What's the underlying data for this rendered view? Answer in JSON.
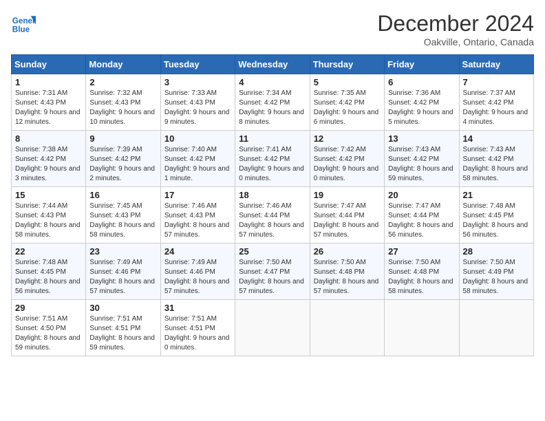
{
  "header": {
    "logo_line1": "General",
    "logo_line2": "Blue",
    "month": "December 2024",
    "location": "Oakville, Ontario, Canada"
  },
  "days_of_week": [
    "Sunday",
    "Monday",
    "Tuesday",
    "Wednesday",
    "Thursday",
    "Friday",
    "Saturday"
  ],
  "weeks": [
    [
      {
        "day": "1",
        "sunrise": "7:31 AM",
        "sunset": "4:43 PM",
        "daylight": "9 hours and 12 minutes."
      },
      {
        "day": "2",
        "sunrise": "7:32 AM",
        "sunset": "4:43 PM",
        "daylight": "9 hours and 10 minutes."
      },
      {
        "day": "3",
        "sunrise": "7:33 AM",
        "sunset": "4:43 PM",
        "daylight": "9 hours and 9 minutes."
      },
      {
        "day": "4",
        "sunrise": "7:34 AM",
        "sunset": "4:42 PM",
        "daylight": "9 hours and 8 minutes."
      },
      {
        "day": "5",
        "sunrise": "7:35 AM",
        "sunset": "4:42 PM",
        "daylight": "9 hours and 6 minutes."
      },
      {
        "day": "6",
        "sunrise": "7:36 AM",
        "sunset": "4:42 PM",
        "daylight": "9 hours and 5 minutes."
      },
      {
        "day": "7",
        "sunrise": "7:37 AM",
        "sunset": "4:42 PM",
        "daylight": "9 hours and 4 minutes."
      }
    ],
    [
      {
        "day": "8",
        "sunrise": "7:38 AM",
        "sunset": "4:42 PM",
        "daylight": "9 hours and 3 minutes."
      },
      {
        "day": "9",
        "sunrise": "7:39 AM",
        "sunset": "4:42 PM",
        "daylight": "9 hours and 2 minutes."
      },
      {
        "day": "10",
        "sunrise": "7:40 AM",
        "sunset": "4:42 PM",
        "daylight": "9 hours and 1 minute."
      },
      {
        "day": "11",
        "sunrise": "7:41 AM",
        "sunset": "4:42 PM",
        "daylight": "9 hours and 0 minutes."
      },
      {
        "day": "12",
        "sunrise": "7:42 AM",
        "sunset": "4:42 PM",
        "daylight": "9 hours and 0 minutes."
      },
      {
        "day": "13",
        "sunrise": "7:43 AM",
        "sunset": "4:42 PM",
        "daylight": "8 hours and 59 minutes."
      },
      {
        "day": "14",
        "sunrise": "7:43 AM",
        "sunset": "4:42 PM",
        "daylight": "8 hours and 58 minutes."
      }
    ],
    [
      {
        "day": "15",
        "sunrise": "7:44 AM",
        "sunset": "4:43 PM",
        "daylight": "8 hours and 58 minutes."
      },
      {
        "day": "16",
        "sunrise": "7:45 AM",
        "sunset": "4:43 PM",
        "daylight": "8 hours and 58 minutes."
      },
      {
        "day": "17",
        "sunrise": "7:46 AM",
        "sunset": "4:43 PM",
        "daylight": "8 hours and 57 minutes."
      },
      {
        "day": "18",
        "sunrise": "7:46 AM",
        "sunset": "4:44 PM",
        "daylight": "8 hours and 57 minutes."
      },
      {
        "day": "19",
        "sunrise": "7:47 AM",
        "sunset": "4:44 PM",
        "daylight": "8 hours and 57 minutes."
      },
      {
        "day": "20",
        "sunrise": "7:47 AM",
        "sunset": "4:44 PM",
        "daylight": "8 hours and 56 minutes."
      },
      {
        "day": "21",
        "sunrise": "7:48 AM",
        "sunset": "4:45 PM",
        "daylight": "8 hours and 56 minutes."
      }
    ],
    [
      {
        "day": "22",
        "sunrise": "7:48 AM",
        "sunset": "4:45 PM",
        "daylight": "8 hours and 56 minutes."
      },
      {
        "day": "23",
        "sunrise": "7:49 AM",
        "sunset": "4:46 PM",
        "daylight": "8 hours and 57 minutes."
      },
      {
        "day": "24",
        "sunrise": "7:49 AM",
        "sunset": "4:46 PM",
        "daylight": "8 hours and 57 minutes."
      },
      {
        "day": "25",
        "sunrise": "7:50 AM",
        "sunset": "4:47 PM",
        "daylight": "8 hours and 57 minutes."
      },
      {
        "day": "26",
        "sunrise": "7:50 AM",
        "sunset": "4:48 PM",
        "daylight": "8 hours and 57 minutes."
      },
      {
        "day": "27",
        "sunrise": "7:50 AM",
        "sunset": "4:48 PM",
        "daylight": "8 hours and 58 minutes."
      },
      {
        "day": "28",
        "sunrise": "7:50 AM",
        "sunset": "4:49 PM",
        "daylight": "8 hours and 58 minutes."
      }
    ],
    [
      {
        "day": "29",
        "sunrise": "7:51 AM",
        "sunset": "4:50 PM",
        "daylight": "8 hours and 59 minutes."
      },
      {
        "day": "30",
        "sunrise": "7:51 AM",
        "sunset": "4:51 PM",
        "daylight": "8 hours and 59 minutes."
      },
      {
        "day": "31",
        "sunrise": "7:51 AM",
        "sunset": "4:51 PM",
        "daylight": "9 hours and 0 minutes."
      },
      null,
      null,
      null,
      null
    ]
  ]
}
